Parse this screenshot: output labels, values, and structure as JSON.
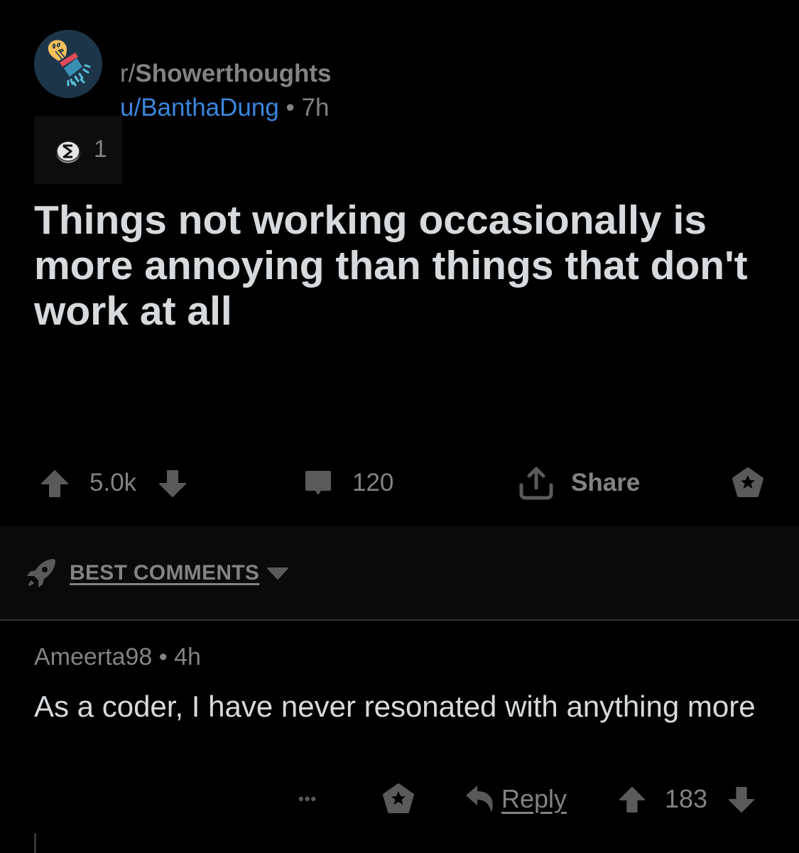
{
  "post": {
    "subreddit_prefix": "r/",
    "subreddit_name": "Showerthoughts",
    "author": "u/BanthaDung",
    "separator": " • ",
    "age": "7h",
    "award_count": "1",
    "title": "Things not working occasionally is more annoying than things that don't work at all",
    "score": "5.0k",
    "comment_count": "120",
    "share_label": "Share"
  },
  "sort": {
    "label": "BEST COMMENTS"
  },
  "comments": [
    {
      "author": "Ameerta98",
      "separator": " • ",
      "age": "4h",
      "body": "As a coder, I have never resonated with anything more",
      "more_label": "•••",
      "reply_label": "Reply",
      "score": "183"
    }
  ],
  "colors": {
    "background": "#000000",
    "text": "#d7dadc",
    "muted": "#818384",
    "link": "#3a86de",
    "icon": "#5a5a5a"
  }
}
